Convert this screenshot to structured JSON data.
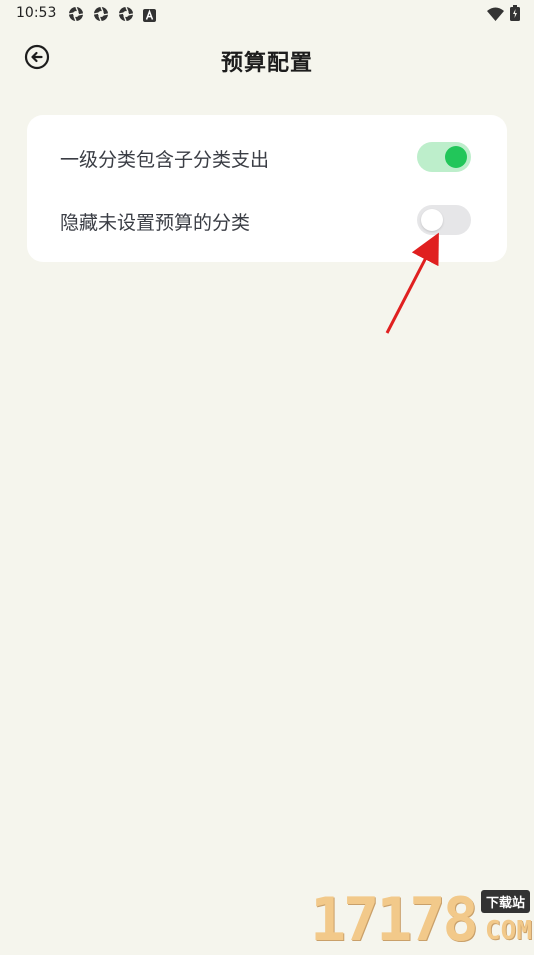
{
  "status_bar": {
    "time": "10:53",
    "notification_icons": [
      "aperture-icon",
      "aperture-icon",
      "aperture-icon",
      "a-box-icon"
    ],
    "right_icons": [
      "wifi-icon",
      "battery-icon"
    ]
  },
  "app_bar": {
    "back_icon": "circle-arrow-left-icon",
    "title": "预算配置"
  },
  "settings": {
    "items": [
      {
        "label": "一级分类包含子分类支出",
        "enabled": true
      },
      {
        "label": "隐藏未设置预算的分类",
        "enabled": false
      }
    ]
  },
  "annotation": {
    "arrow_color": "#e02020"
  },
  "watermark": {
    "digits": "17178",
    "tag": "下载站",
    "suffix": "COM"
  },
  "colors": {
    "background": "#f5f5ed",
    "card": "#ffffff",
    "switch_on_track": "#bdeecb",
    "switch_on_knob": "#22c65a",
    "switch_off_track": "#e6e6e8"
  }
}
